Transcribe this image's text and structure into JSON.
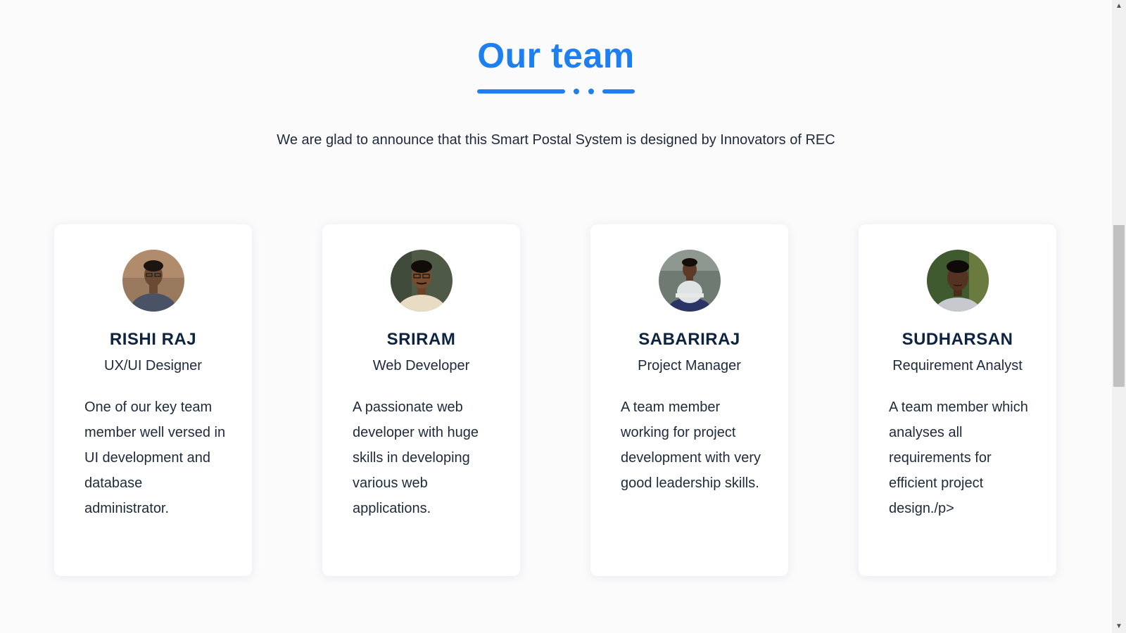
{
  "header": {
    "title": "Our team",
    "subtitle": "We are glad to announce that this Smart Postal System is designed by Innovators of REC"
  },
  "team": [
    {
      "name": "RISHI RAJ",
      "role": "UX/UI Designer",
      "description": "One of our key team member well versed in UI development and database administrator.",
      "avatar": "team-member-photo"
    },
    {
      "name": "SRIRAM",
      "role": "Web Developer",
      "description": "A passionate web developer with huge skills in developing various web applications.",
      "avatar": "team-member-photo"
    },
    {
      "name": "SABARIRAJ",
      "role": "Project Manager",
      "description": "A team member working for project development with very good leadership skills.",
      "avatar": "team-member-photo"
    },
    {
      "name": "SUDHARSAN",
      "role": "Requirement Analyst",
      "description": "A team member which analyses all requirements for efficient project design./p>",
      "avatar": "team-member-photo"
    }
  ],
  "colors": {
    "accent": "#1d7ff0",
    "heading": "#0d2340",
    "text": "#1e2a3b",
    "background": "#fbfbfc",
    "card": "#ffffff"
  },
  "icons": {
    "scroll_up": "scroll-up-arrow-icon",
    "scroll_down": "scroll-down-arrow-icon"
  }
}
